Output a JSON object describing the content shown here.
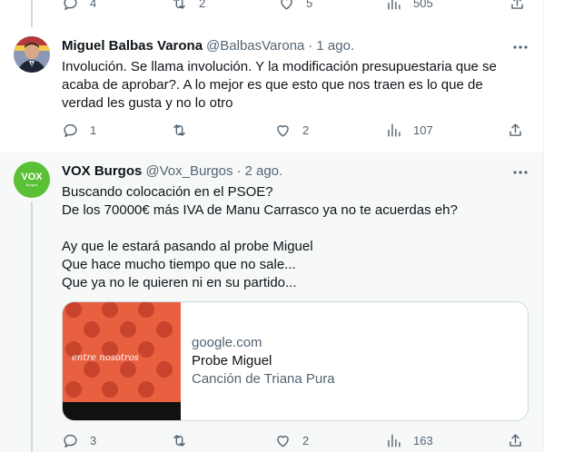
{
  "top_actions": {
    "reply": "4",
    "retweet": "2",
    "like": "5",
    "views": "505"
  },
  "tweet1": {
    "name": "Miguel Balbas Varona",
    "handle": "@BalbasVarona",
    "time": "1 ago.",
    "text": "Involución. Se llama involución. Y la modificación presupuestaria que se\nacaba de aprobar?. A lo mejor es que esto que nos traen es lo que de\nverdad les gusta y no lo otro",
    "replies": "1",
    "retweets": "",
    "likes": "2",
    "views": "107"
  },
  "tweet2": {
    "name": "VOX Burgos",
    "handle": "@Vox_Burgos",
    "time": "2 ago.",
    "avatar_text": "VOX",
    "avatar_sub": "Burgos",
    "text": "Buscando colocación en el PSOE?\nDe los 70000€ más IVA de Manu Carrasco ya no te acuerdas eh?\n\nAy que le estará pasando al probe Miguel\nQue hace mucho tiempo que no sale...\nQue ya no le quieren ni en su partido...",
    "card": {
      "thumb_text": "entre nosotros",
      "domain": "google.com",
      "title": "Probe Miguel",
      "description": "Canción de Triana Pura"
    },
    "replies": "3",
    "retweets": "",
    "likes": "2",
    "views": "163"
  },
  "colors": {
    "vox_green": "#5ac035",
    "thumb_orange": "#e25b3c",
    "thumb_dot": "#c8402a"
  }
}
